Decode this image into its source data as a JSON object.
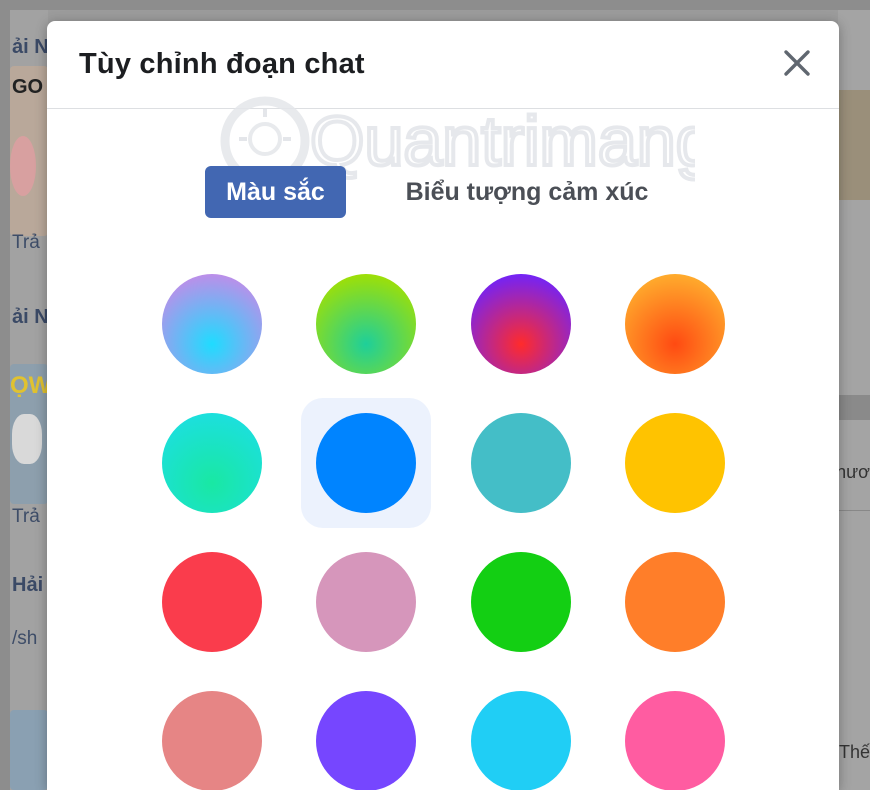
{
  "background": {
    "left_labels": [
      "ải N",
      "Trả",
      "ải N",
      "Trả",
      "Hải",
      "/sh"
    ],
    "sticker_text": [
      "GO",
      "ỌW"
    ],
    "right_labels": [
      "hươ",
      "Thế"
    ]
  },
  "modal": {
    "title": "Tùy chỉnh đoạn chat",
    "close_icon": "close-icon",
    "watermark": "Quantrimang"
  },
  "tabs": [
    {
      "label": "Màu sắc",
      "active": true
    },
    {
      "label": "Biểu tượng cảm xúc",
      "active": false
    }
  ],
  "swatches": [
    {
      "name": "lavender-cyan-gradient",
      "colors": [
        "#c38be8",
        "#1fdcff"
      ],
      "selected": false
    },
    {
      "name": "lime-green-gradient",
      "colors": [
        "#a4e000",
        "#1ecf9a"
      ],
      "selected": false
    },
    {
      "name": "purple-red-gradient",
      "colors": [
        "#6d23ff",
        "#ff2b2b"
      ],
      "selected": false
    },
    {
      "name": "orange-red-gradient",
      "colors": [
        "#ffb02e",
        "#ff4a12"
      ],
      "selected": false
    },
    {
      "name": "teal-green-gradient",
      "colors": [
        "#1cdfe0",
        "#19e8a3"
      ],
      "selected": false
    },
    {
      "name": "blue",
      "colors": [
        "#0084ff"
      ],
      "selected": true
    },
    {
      "name": "teal",
      "colors": [
        "#44bec7"
      ],
      "selected": false
    },
    {
      "name": "yellow",
      "colors": [
        "#ffc300"
      ],
      "selected": false
    },
    {
      "name": "red",
      "colors": [
        "#fa3c4c"
      ],
      "selected": false
    },
    {
      "name": "pink-mauve",
      "colors": [
        "#d696bb"
      ],
      "selected": false
    },
    {
      "name": "green",
      "colors": [
        "#13cf13"
      ],
      "selected": false
    },
    {
      "name": "orange",
      "colors": [
        "#ff7e29"
      ],
      "selected": false
    },
    {
      "name": "salmon",
      "colors": [
        "#e68585"
      ],
      "selected": false
    },
    {
      "name": "violet",
      "colors": [
        "#7646ff"
      ],
      "selected": false
    },
    {
      "name": "sky-blue",
      "colors": [
        "#20cef5"
      ],
      "selected": false
    },
    {
      "name": "hot-pink",
      "colors": [
        "#ff5ca1"
      ],
      "selected": false
    }
  ],
  "colors": {
    "accent": "#4267b2",
    "selected_bg": "#ecf2fd",
    "title": "#1c1e21"
  }
}
